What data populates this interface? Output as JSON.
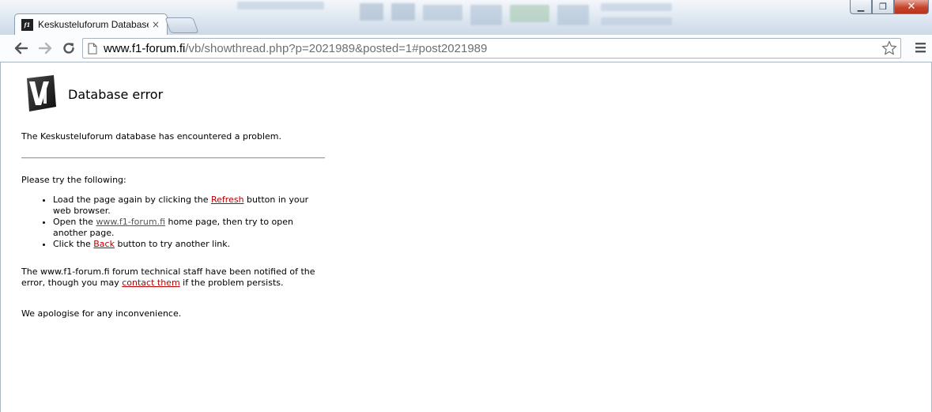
{
  "window": {
    "controls": {
      "minimize": "▁",
      "restore": "❐",
      "close": "✕"
    }
  },
  "tab": {
    "favicon_text": "f1",
    "title": "Keskusteluforum Database",
    "close": "×"
  },
  "toolbar": {
    "url_host": "www.f1-forum.fi",
    "url_rest": "/vb/showthread.php?p=2021989&posted=1#post2021989"
  },
  "page": {
    "heading": "Database error",
    "intro": "The Keskusteluforum database has encountered a problem.",
    "try_following": "Please try the following:",
    "items": [
      {
        "before": "Load the page again by clicking the ",
        "link": "Refresh",
        "after": " button in your web browser."
      },
      {
        "before": "Open the ",
        "link": "www.f1-forum.fi",
        "after": " home page, then try to open another page."
      },
      {
        "before": "Click the ",
        "link": "Back",
        "after": " button to try another link."
      }
    ],
    "notified_before": "The www.f1-forum.fi forum technical staff have been notified of the error, though you may ",
    "notified_link": "contact them",
    "notified_after": " if the problem persists.",
    "apology": "We apologise for any inconvenience."
  },
  "colors": {
    "link": "#b40000",
    "chrome_frame": "#cdd9e6"
  }
}
